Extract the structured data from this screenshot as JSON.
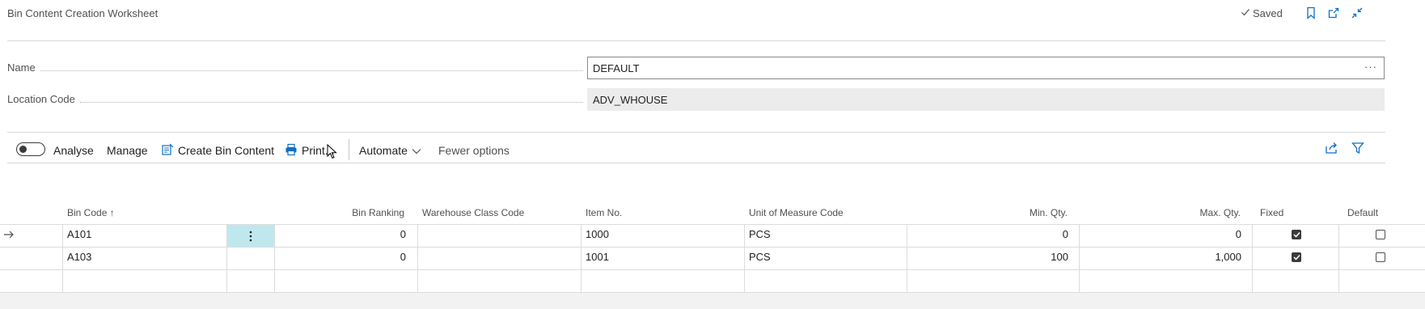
{
  "header": {
    "title": "Bin Content Creation Worksheet",
    "saved_label": "Saved",
    "icons": [
      "bookmark-icon",
      "open-new-window-icon",
      "collapse-icon"
    ]
  },
  "fields": {
    "name": {
      "label": "Name",
      "value": "DEFAULT"
    },
    "location_code": {
      "label": "Location Code",
      "value": "ADV_WHOUSE"
    }
  },
  "toolbar": {
    "analyse_label": "Analyse",
    "analyse_on": false,
    "manage_label": "Manage",
    "create_bin_content_label": "Create Bin Content",
    "print_label": "Print...",
    "automate_label": "Automate",
    "fewer_options_label": "Fewer options",
    "right_icons": [
      "share-icon",
      "filter-icon"
    ]
  },
  "table": {
    "columns": {
      "bin_code": "Bin Code",
      "bin_ranking": "Bin Ranking",
      "warehouse_class_code": "Warehouse Class Code",
      "item_no": "Item No.",
      "unit_of_measure_code": "Unit of Measure Code",
      "min_qty": "Min. Qty.",
      "max_qty": "Max. Qty.",
      "fixed": "Fixed",
      "default": "Default"
    },
    "sort_indicator": "↑",
    "rows": [
      {
        "bin_code": "A101",
        "bin_ranking": "0",
        "warehouse_class_code": "",
        "item_no": "1000",
        "unit_of_measure_code": "PCS",
        "min_qty": "0",
        "max_qty": "0",
        "fixed": true,
        "default": false,
        "selected": true
      },
      {
        "bin_code": "A103",
        "bin_ranking": "0",
        "warehouse_class_code": "",
        "item_no": "1001",
        "unit_of_measure_code": "PCS",
        "min_qty": "100",
        "max_qty": "1,000",
        "fixed": true,
        "default": false,
        "selected": false
      }
    ]
  },
  "colors": {
    "accent": "#0f6fc6",
    "selected_cell": "#bfe8ee",
    "field_readonly_bg": "#ececec"
  }
}
